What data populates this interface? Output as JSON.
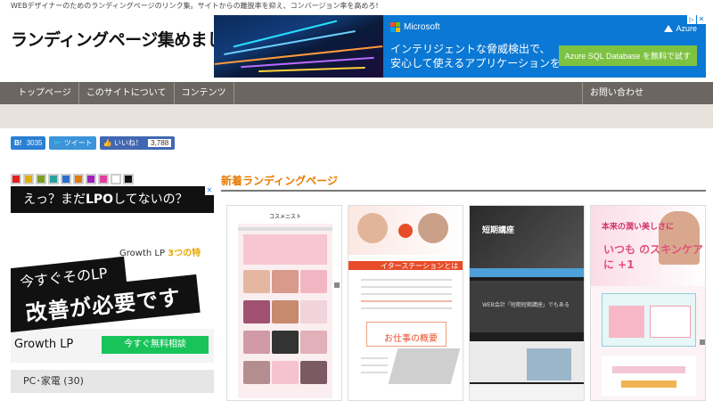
{
  "header": {
    "tagline": "WEBデザイナーのためのランディングページのリンク集。サイトからの離脱率を抑え、コンバージョン率を高めろ!",
    "logo": "ランディングページ集めました。"
  },
  "top_ad": {
    "brand": "Microsoft",
    "product": "Azure",
    "copy_line1": "インテリジェントな脅威検出で、",
    "copy_line2": "安心して使えるアプリケーションを",
    "cta": "Azure SQL Database を無料で試す"
  },
  "nav": {
    "items": [
      "トップページ",
      "このサイトについて",
      "コンテンツ"
    ],
    "contact": "お問い合わせ"
  },
  "social": {
    "hatena_label": "B!",
    "hatena_count": "3035",
    "tweet": "ツイート",
    "like": "いいね！",
    "like_count": "3,788"
  },
  "color_filters": [
    "#e02020",
    "#e0b000",
    "#7aa020",
    "#2aa0a0",
    "#2a70c8",
    "#e07a10",
    "#a020c0",
    "#e040a0",
    "#ffffff",
    "#111111"
  ],
  "side_ad": {
    "top_text_a": "えっ？まだ",
    "top_text_b": "LPO",
    "top_text_c": "してないの？",
    "product_small": "Growth LP",
    "product_hint": "3つの特",
    "banner_line1": "今すぐそのLP",
    "banner_line2": "改善が必要です",
    "brand": "Growth LP",
    "cta": "今すぐ無料相談"
  },
  "category": {
    "label": "PC･家電 (30)"
  },
  "main": {
    "section_title": "新着ランディングページ",
    "thumb1_logo": "コスメニスト",
    "thumb2_heading": "イターステーションとは",
    "thumb2_sub": "お仕事の概要",
    "thumb3_title": "短期講座",
    "thumb3_caption": "WEB会計「短期短期講座」でもある",
    "thumb4_title": "本来の潤い美しさに",
    "thumb4_big": "いつも のスキンケアに +1"
  },
  "colors": {
    "nav_bg": "#6b6661",
    "subbar_bg": "#e7e3dc",
    "accent": "#e87a00",
    "ad_blue": "#0a78d4",
    "ad_green": "#7ec242",
    "side_cta_green": "#18c45a"
  }
}
